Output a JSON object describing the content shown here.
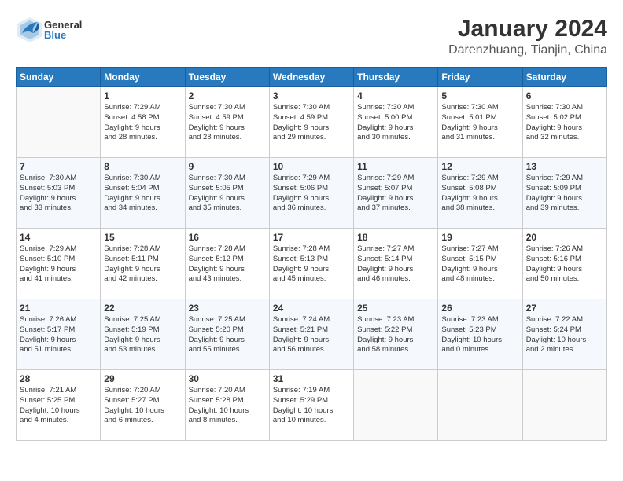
{
  "app": {
    "logo_general": "General",
    "logo_blue": "Blue"
  },
  "header": {
    "month_title": "January 2024",
    "location": "Darenzhuang, Tianjin, China"
  },
  "weekdays": [
    "Sunday",
    "Monday",
    "Tuesday",
    "Wednesday",
    "Thursday",
    "Friday",
    "Saturday"
  ],
  "weeks": [
    [
      {
        "day": "",
        "info": ""
      },
      {
        "day": "1",
        "info": "Sunrise: 7:29 AM\nSunset: 4:58 PM\nDaylight: 9 hours\nand 28 minutes."
      },
      {
        "day": "2",
        "info": "Sunrise: 7:30 AM\nSunset: 4:59 PM\nDaylight: 9 hours\nand 28 minutes."
      },
      {
        "day": "3",
        "info": "Sunrise: 7:30 AM\nSunset: 4:59 PM\nDaylight: 9 hours\nand 29 minutes."
      },
      {
        "day": "4",
        "info": "Sunrise: 7:30 AM\nSunset: 5:00 PM\nDaylight: 9 hours\nand 30 minutes."
      },
      {
        "day": "5",
        "info": "Sunrise: 7:30 AM\nSunset: 5:01 PM\nDaylight: 9 hours\nand 31 minutes."
      },
      {
        "day": "6",
        "info": "Sunrise: 7:30 AM\nSunset: 5:02 PM\nDaylight: 9 hours\nand 32 minutes."
      }
    ],
    [
      {
        "day": "7",
        "info": "Sunrise: 7:30 AM\nSunset: 5:03 PM\nDaylight: 9 hours\nand 33 minutes."
      },
      {
        "day": "8",
        "info": "Sunrise: 7:30 AM\nSunset: 5:04 PM\nDaylight: 9 hours\nand 34 minutes."
      },
      {
        "day": "9",
        "info": "Sunrise: 7:30 AM\nSunset: 5:05 PM\nDaylight: 9 hours\nand 35 minutes."
      },
      {
        "day": "10",
        "info": "Sunrise: 7:29 AM\nSunset: 5:06 PM\nDaylight: 9 hours\nand 36 minutes."
      },
      {
        "day": "11",
        "info": "Sunrise: 7:29 AM\nSunset: 5:07 PM\nDaylight: 9 hours\nand 37 minutes."
      },
      {
        "day": "12",
        "info": "Sunrise: 7:29 AM\nSunset: 5:08 PM\nDaylight: 9 hours\nand 38 minutes."
      },
      {
        "day": "13",
        "info": "Sunrise: 7:29 AM\nSunset: 5:09 PM\nDaylight: 9 hours\nand 39 minutes."
      }
    ],
    [
      {
        "day": "14",
        "info": "Sunrise: 7:29 AM\nSunset: 5:10 PM\nDaylight: 9 hours\nand 41 minutes."
      },
      {
        "day": "15",
        "info": "Sunrise: 7:28 AM\nSunset: 5:11 PM\nDaylight: 9 hours\nand 42 minutes."
      },
      {
        "day": "16",
        "info": "Sunrise: 7:28 AM\nSunset: 5:12 PM\nDaylight: 9 hours\nand 43 minutes."
      },
      {
        "day": "17",
        "info": "Sunrise: 7:28 AM\nSunset: 5:13 PM\nDaylight: 9 hours\nand 45 minutes."
      },
      {
        "day": "18",
        "info": "Sunrise: 7:27 AM\nSunset: 5:14 PM\nDaylight: 9 hours\nand 46 minutes."
      },
      {
        "day": "19",
        "info": "Sunrise: 7:27 AM\nSunset: 5:15 PM\nDaylight: 9 hours\nand 48 minutes."
      },
      {
        "day": "20",
        "info": "Sunrise: 7:26 AM\nSunset: 5:16 PM\nDaylight: 9 hours\nand 50 minutes."
      }
    ],
    [
      {
        "day": "21",
        "info": "Sunrise: 7:26 AM\nSunset: 5:17 PM\nDaylight: 9 hours\nand 51 minutes."
      },
      {
        "day": "22",
        "info": "Sunrise: 7:25 AM\nSunset: 5:19 PM\nDaylight: 9 hours\nand 53 minutes."
      },
      {
        "day": "23",
        "info": "Sunrise: 7:25 AM\nSunset: 5:20 PM\nDaylight: 9 hours\nand 55 minutes."
      },
      {
        "day": "24",
        "info": "Sunrise: 7:24 AM\nSunset: 5:21 PM\nDaylight: 9 hours\nand 56 minutes."
      },
      {
        "day": "25",
        "info": "Sunrise: 7:23 AM\nSunset: 5:22 PM\nDaylight: 9 hours\nand 58 minutes."
      },
      {
        "day": "26",
        "info": "Sunrise: 7:23 AM\nSunset: 5:23 PM\nDaylight: 10 hours\nand 0 minutes."
      },
      {
        "day": "27",
        "info": "Sunrise: 7:22 AM\nSunset: 5:24 PM\nDaylight: 10 hours\nand 2 minutes."
      }
    ],
    [
      {
        "day": "28",
        "info": "Sunrise: 7:21 AM\nSunset: 5:25 PM\nDaylight: 10 hours\nand 4 minutes."
      },
      {
        "day": "29",
        "info": "Sunrise: 7:20 AM\nSunset: 5:27 PM\nDaylight: 10 hours\nand 6 minutes."
      },
      {
        "day": "30",
        "info": "Sunrise: 7:20 AM\nSunset: 5:28 PM\nDaylight: 10 hours\nand 8 minutes."
      },
      {
        "day": "31",
        "info": "Sunrise: 7:19 AM\nSunset: 5:29 PM\nDaylight: 10 hours\nand 10 minutes."
      },
      {
        "day": "",
        "info": ""
      },
      {
        "day": "",
        "info": ""
      },
      {
        "day": "",
        "info": ""
      }
    ]
  ]
}
